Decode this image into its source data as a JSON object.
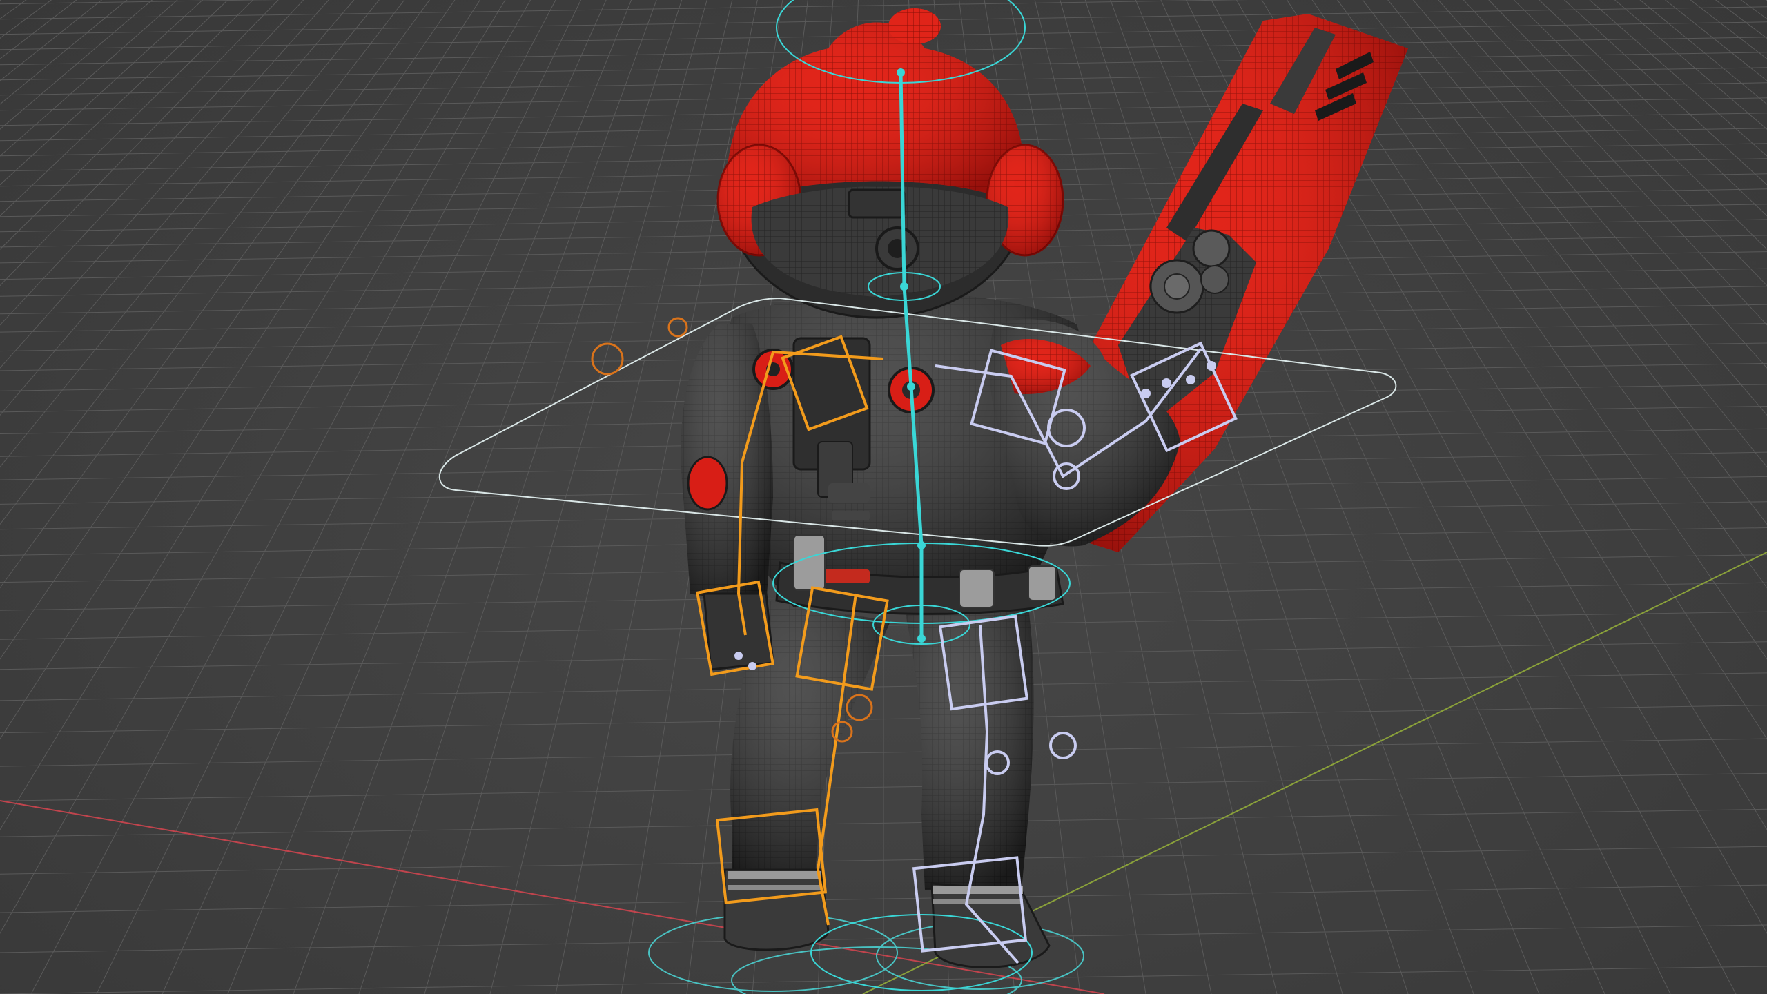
{
  "viewport": {
    "mode": "3d-rig-viewport",
    "background": "#3f3f3f",
    "grid_color": "#5a5a5a",
    "x_axis_color": "#c0444d",
    "y_axis_color": "#8aa13a"
  },
  "scene": {
    "character": "armored-soldier-red-helmet-wireframe",
    "prop": "red-rifle",
    "rig_colors": {
      "spine": "#3ad6d6",
      "left_chain": "#f29b1c",
      "right_chain": "#c9ccf0",
      "root": "#49c2c2",
      "helper_orange": "#d9731b"
    },
    "mesh_colors": {
      "red_parts": "#e2231a",
      "body": "#3b3b3b",
      "wireframe": "#1e1e1e"
    }
  }
}
